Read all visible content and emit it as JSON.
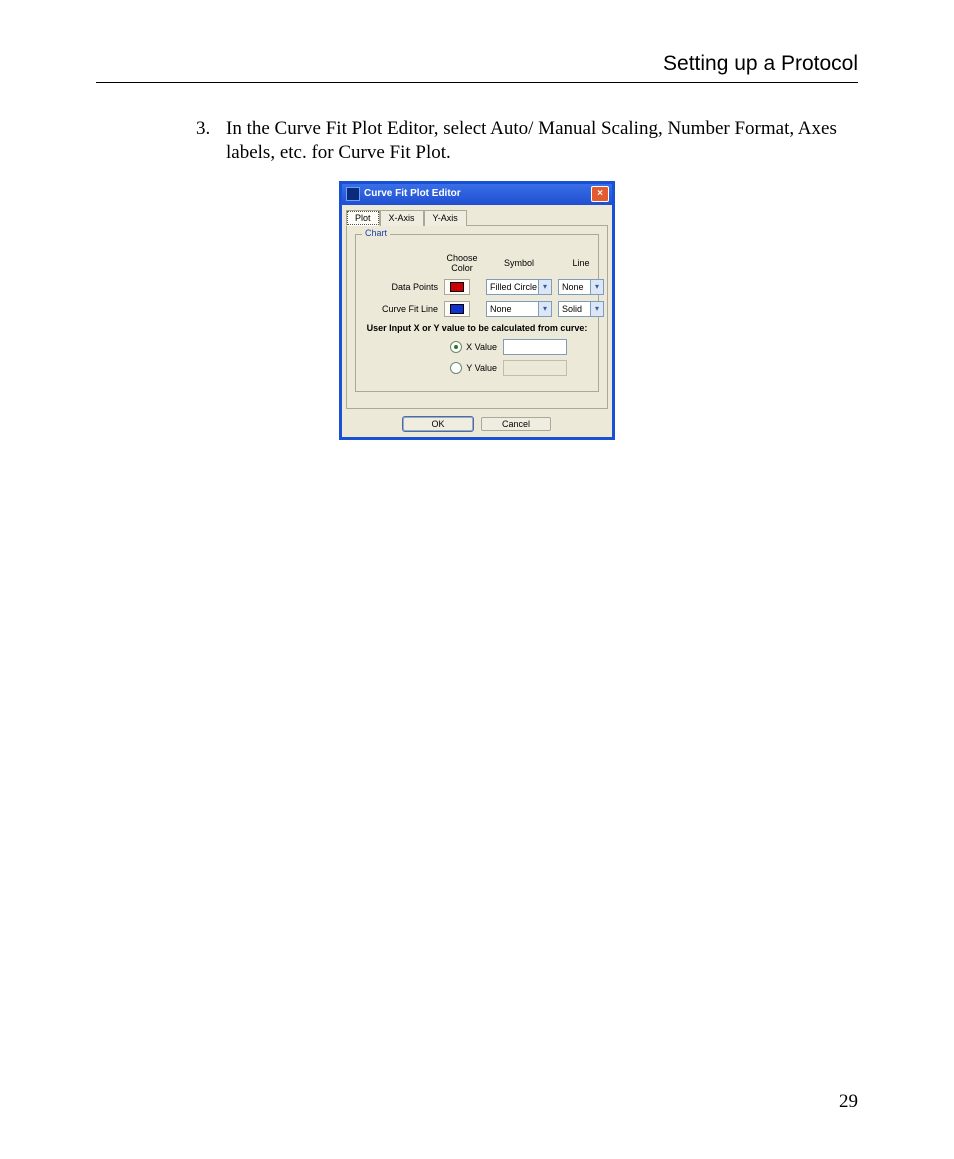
{
  "header": {
    "running_title": "Setting up a Protocol"
  },
  "list": {
    "number": "3.",
    "text": "In the Curve Fit Plot Editor, select Auto/ Manual Scaling, Number Format, Axes labels, etc. for Curve Fit Plot."
  },
  "dialog": {
    "title": "Curve Fit Plot Editor",
    "tabs": [
      "Plot",
      "X-Axis",
      "Y-Axis"
    ],
    "active_tab": "Plot",
    "group_title": "Chart",
    "headers": {
      "choose_color": "Choose Color",
      "symbol": "Symbol",
      "line": "Line"
    },
    "rows": {
      "data_points": {
        "label": "Data Points",
        "color": "#c00000",
        "symbol": "Filled Circle",
        "line": "None"
      },
      "curve_fit_line": {
        "label": "Curve Fit Line",
        "color": "#1030c0",
        "symbol": "None",
        "line": "Solid"
      }
    },
    "user_input_heading": "User Input X or Y value to be calculated from curve:",
    "radios": {
      "x": {
        "label": "X Value",
        "selected": true,
        "value": ""
      },
      "y": {
        "label": "Y Value",
        "selected": false,
        "value": ""
      }
    },
    "buttons": {
      "ok": "OK",
      "cancel": "Cancel"
    }
  },
  "page_number": "29"
}
